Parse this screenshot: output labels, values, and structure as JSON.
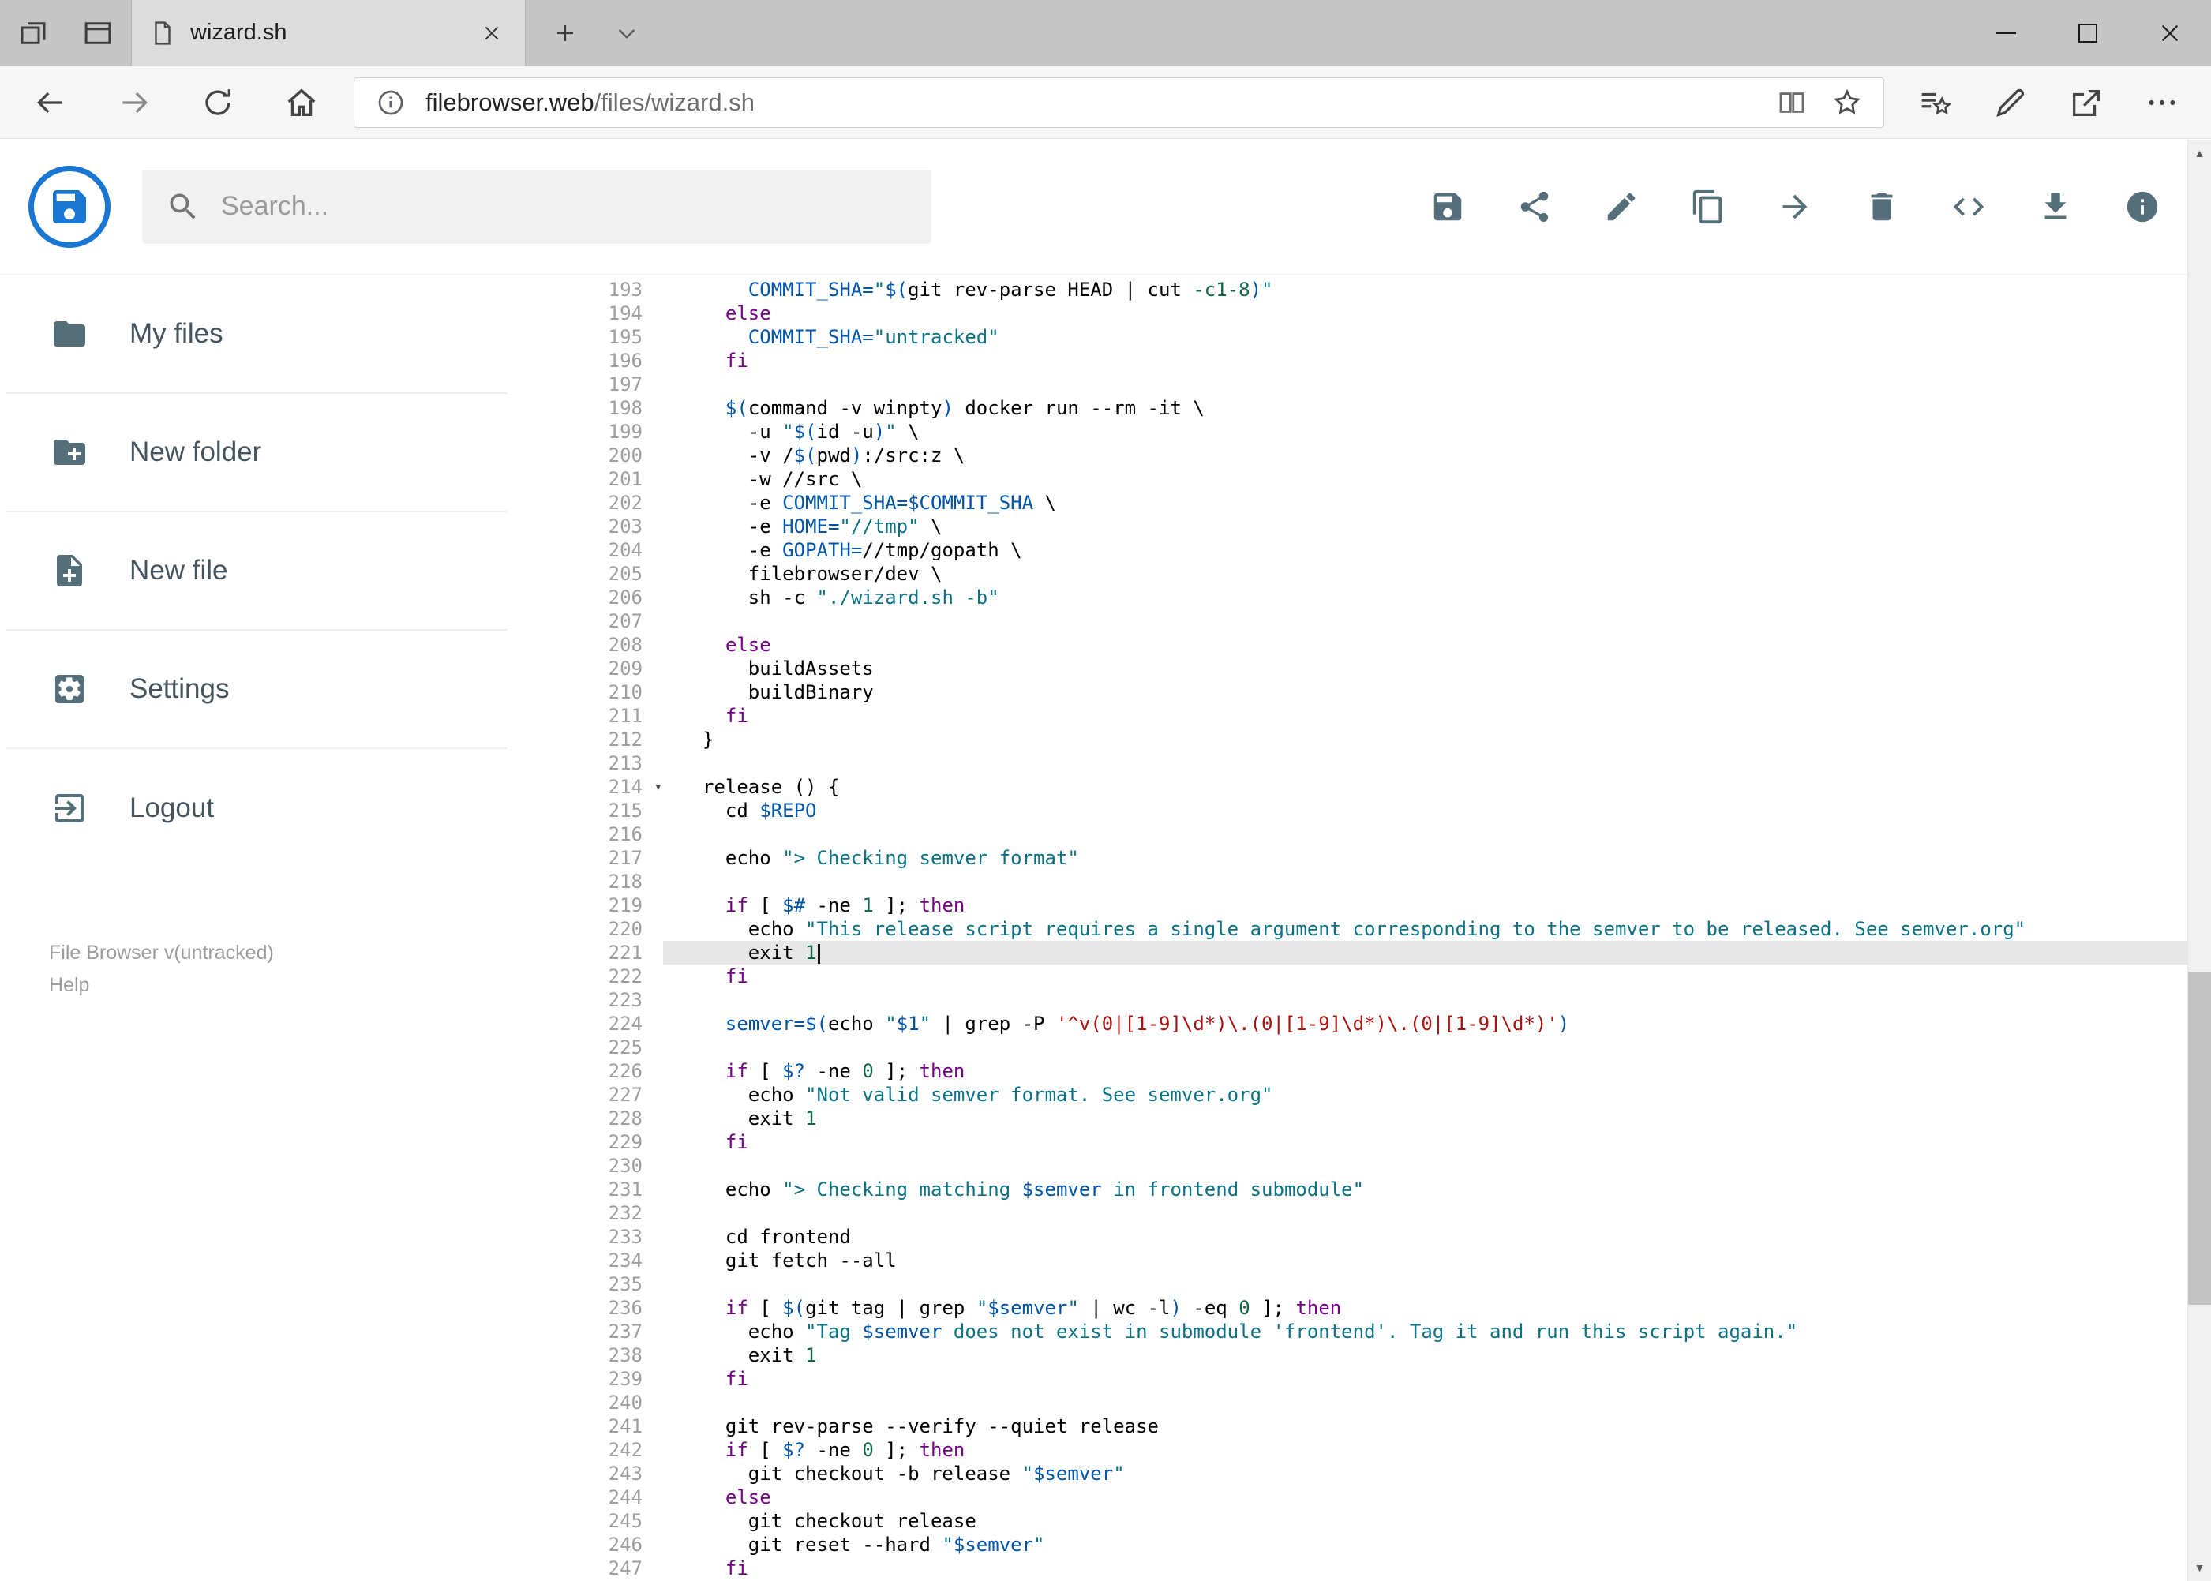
{
  "browser": {
    "tab_title": "wizard.sh",
    "url_domain": "filebrowser.web",
    "url_path": "/files/wizard.sh"
  },
  "header": {
    "search_placeholder": "Search..."
  },
  "toolbar_icons": [
    "save",
    "share",
    "rename",
    "copy",
    "move",
    "delete",
    "raw-code",
    "download",
    "info"
  ],
  "sidebar": {
    "items": [
      {
        "label": "My files",
        "icon": "folder"
      },
      {
        "label": "New folder",
        "icon": "create-new-folder"
      },
      {
        "label": "New file",
        "icon": "new-file"
      },
      {
        "label": "Settings",
        "icon": "settings"
      },
      {
        "label": "Logout",
        "icon": "logout"
      }
    ],
    "footer_version": "File Browser v(untracked)",
    "footer_help": "Help"
  },
  "colors": {
    "accent_blue": "#1976d2",
    "icon_gray": "#546e7a",
    "tok_keyword": "#770088",
    "tok_string": "#0b7285",
    "tok_variable": "#0055aa",
    "tok_number": "#116644",
    "tok_regex": "#aa1111",
    "active_line_bg": "#e7e7e7"
  },
  "editor": {
    "first_line": 193,
    "last_line": 247,
    "active_line": 221,
    "cursor_line": 221,
    "fold_marker_line": 214,
    "lines": [
      {
        "n": 193,
        "t": [
          [
            "pl",
            "    "
          ],
          [
            "vr",
            "COMMIT_SHA="
          ],
          [
            "st",
            "\""
          ],
          [
            "vr",
            "$("
          ],
          [
            "pl",
            "git rev-parse HEAD | cut "
          ],
          [
            "nm",
            "-c1-8"
          ],
          [
            "vr",
            ")"
          ],
          [
            "st",
            "\""
          ]
        ]
      },
      {
        "n": 194,
        "t": [
          [
            "pl",
            "  "
          ],
          [
            "kw",
            "else"
          ]
        ]
      },
      {
        "n": 195,
        "t": [
          [
            "pl",
            "    "
          ],
          [
            "vr",
            "COMMIT_SHA="
          ],
          [
            "st",
            "\"untracked\""
          ]
        ]
      },
      {
        "n": 196,
        "t": [
          [
            "pl",
            "  "
          ],
          [
            "kw",
            "fi"
          ]
        ]
      },
      {
        "n": 197,
        "t": []
      },
      {
        "n": 198,
        "t": [
          [
            "pl",
            "  "
          ],
          [
            "vr",
            "$("
          ],
          [
            "pl",
            "command -v winpty"
          ],
          [
            "vr",
            ")"
          ],
          [
            "pl",
            " docker run --rm -it \\"
          ]
        ]
      },
      {
        "n": 199,
        "t": [
          [
            "pl",
            "    -u "
          ],
          [
            "st",
            "\""
          ],
          [
            "vr",
            "$("
          ],
          [
            "pl",
            "id -u"
          ],
          [
            "vr",
            ")"
          ],
          [
            "st",
            "\""
          ],
          [
            "pl",
            " \\"
          ]
        ]
      },
      {
        "n": 200,
        "t": [
          [
            "pl",
            "    -v /"
          ],
          [
            "vr",
            "$("
          ],
          [
            "pl",
            "pwd"
          ],
          [
            "vr",
            ")"
          ],
          [
            "pl",
            ":/src:z \\"
          ]
        ]
      },
      {
        "n": 201,
        "t": [
          [
            "pl",
            "    -w //src \\"
          ]
        ]
      },
      {
        "n": 202,
        "t": [
          [
            "pl",
            "    -e "
          ],
          [
            "vr",
            "COMMIT_SHA=$COMMIT_SHA"
          ],
          [
            "pl",
            " \\"
          ]
        ]
      },
      {
        "n": 203,
        "t": [
          [
            "pl",
            "    -e "
          ],
          [
            "vr",
            "HOME="
          ],
          [
            "st",
            "\"//tmp\""
          ],
          [
            "pl",
            " \\"
          ]
        ]
      },
      {
        "n": 204,
        "t": [
          [
            "pl",
            "    -e "
          ],
          [
            "vr",
            "GOPATH="
          ],
          [
            "pl",
            "//tmp/gopath \\"
          ]
        ]
      },
      {
        "n": 205,
        "t": [
          [
            "pl",
            "    filebrowser/dev \\"
          ]
        ]
      },
      {
        "n": 206,
        "t": [
          [
            "pl",
            "    sh -c "
          ],
          [
            "st",
            "\"./wizard.sh -b\""
          ]
        ]
      },
      {
        "n": 207,
        "t": []
      },
      {
        "n": 208,
        "t": [
          [
            "pl",
            "  "
          ],
          [
            "kw",
            "else"
          ]
        ]
      },
      {
        "n": 209,
        "t": [
          [
            "pl",
            "    buildAssets"
          ]
        ]
      },
      {
        "n": 210,
        "t": [
          [
            "pl",
            "    buildBinary"
          ]
        ]
      },
      {
        "n": 211,
        "t": [
          [
            "pl",
            "  "
          ],
          [
            "kw",
            "fi"
          ]
        ]
      },
      {
        "n": 212,
        "t": [
          [
            "pl",
            "}"
          ]
        ]
      },
      {
        "n": 213,
        "t": []
      },
      {
        "n": 214,
        "t": [
          [
            "pl",
            "release () {"
          ]
        ]
      },
      {
        "n": 215,
        "t": [
          [
            "pl",
            "  cd "
          ],
          [
            "vr",
            "$REPO"
          ]
        ]
      },
      {
        "n": 216,
        "t": []
      },
      {
        "n": 217,
        "t": [
          [
            "pl",
            "  echo "
          ],
          [
            "st",
            "\"> Checking semver format\""
          ]
        ]
      },
      {
        "n": 218,
        "t": []
      },
      {
        "n": 219,
        "t": [
          [
            "pl",
            "  "
          ],
          [
            "kw",
            "if"
          ],
          [
            "pl",
            " [ "
          ],
          [
            "vr",
            "$#"
          ],
          [
            "pl",
            " -ne "
          ],
          [
            "nm",
            "1"
          ],
          [
            "pl",
            " ]; "
          ],
          [
            "kw",
            "then"
          ]
        ]
      },
      {
        "n": 220,
        "t": [
          [
            "pl",
            "    echo "
          ],
          [
            "st",
            "\"This release script requires a single argument corresponding to the semver to be released. See semver.org\""
          ]
        ]
      },
      {
        "n": 221,
        "t": [
          [
            "pl",
            "    exit "
          ],
          [
            "nm",
            "1"
          ]
        ]
      },
      {
        "n": 222,
        "t": [
          [
            "pl",
            "  "
          ],
          [
            "kw",
            "fi"
          ]
        ]
      },
      {
        "n": 223,
        "t": []
      },
      {
        "n": 224,
        "t": [
          [
            "pl",
            "  "
          ],
          [
            "vr",
            "semver=$("
          ],
          [
            "pl",
            "echo "
          ],
          [
            "st",
            "\""
          ],
          [
            "vr",
            "$1"
          ],
          [
            "st",
            "\""
          ],
          [
            "pl",
            " | grep -P "
          ],
          [
            "rx",
            "'^v(0|[1-9]\\d*)\\.(0|[1-9]\\d*)\\.(0|[1-9]\\d*)'"
          ],
          [
            "vr",
            ")"
          ]
        ]
      },
      {
        "n": 225,
        "t": []
      },
      {
        "n": 226,
        "t": [
          [
            "pl",
            "  "
          ],
          [
            "kw",
            "if"
          ],
          [
            "pl",
            " [ "
          ],
          [
            "vr",
            "$?"
          ],
          [
            "pl",
            " -ne "
          ],
          [
            "nm",
            "0"
          ],
          [
            "pl",
            " ]; "
          ],
          [
            "kw",
            "then"
          ]
        ]
      },
      {
        "n": 227,
        "t": [
          [
            "pl",
            "    echo "
          ],
          [
            "st",
            "\"Not valid semver format. See semver.org\""
          ]
        ]
      },
      {
        "n": 228,
        "t": [
          [
            "pl",
            "    exit "
          ],
          [
            "nm",
            "1"
          ]
        ]
      },
      {
        "n": 229,
        "t": [
          [
            "pl",
            "  "
          ],
          [
            "kw",
            "fi"
          ]
        ]
      },
      {
        "n": 230,
        "t": []
      },
      {
        "n": 231,
        "t": [
          [
            "pl",
            "  echo "
          ],
          [
            "st",
            "\"> Checking matching "
          ],
          [
            "vr",
            "$semver"
          ],
          [
            "st",
            " in frontend submodule\""
          ]
        ]
      },
      {
        "n": 232,
        "t": []
      },
      {
        "n": 233,
        "t": [
          [
            "pl",
            "  cd frontend"
          ]
        ]
      },
      {
        "n": 234,
        "t": [
          [
            "pl",
            "  git fetch --all"
          ]
        ]
      },
      {
        "n": 235,
        "t": []
      },
      {
        "n": 236,
        "t": [
          [
            "pl",
            "  "
          ],
          [
            "kw",
            "if"
          ],
          [
            "pl",
            " [ "
          ],
          [
            "vr",
            "$("
          ],
          [
            "pl",
            "git tag | grep "
          ],
          [
            "st",
            "\""
          ],
          [
            "vr",
            "$semver"
          ],
          [
            "st",
            "\""
          ],
          [
            "pl",
            " | wc -l"
          ],
          [
            "vr",
            ")"
          ],
          [
            "pl",
            " -eq "
          ],
          [
            "nm",
            "0"
          ],
          [
            "pl",
            " ]; "
          ],
          [
            "kw",
            "then"
          ]
        ]
      },
      {
        "n": 237,
        "t": [
          [
            "pl",
            "    echo "
          ],
          [
            "st",
            "\"Tag "
          ],
          [
            "vr",
            "$semver"
          ],
          [
            "st",
            " does not exist in submodule 'frontend'. Tag it and run this script again.\""
          ]
        ]
      },
      {
        "n": 238,
        "t": [
          [
            "pl",
            "    exit "
          ],
          [
            "nm",
            "1"
          ]
        ]
      },
      {
        "n": 239,
        "t": [
          [
            "pl",
            "  "
          ],
          [
            "kw",
            "fi"
          ]
        ]
      },
      {
        "n": 240,
        "t": []
      },
      {
        "n": 241,
        "t": [
          [
            "pl",
            "  git rev-parse --verify --quiet release"
          ]
        ]
      },
      {
        "n": 242,
        "t": [
          [
            "pl",
            "  "
          ],
          [
            "kw",
            "if"
          ],
          [
            "pl",
            " [ "
          ],
          [
            "vr",
            "$?"
          ],
          [
            "pl",
            " -ne "
          ],
          [
            "nm",
            "0"
          ],
          [
            "pl",
            " ]; "
          ],
          [
            "kw",
            "then"
          ]
        ]
      },
      {
        "n": 243,
        "t": [
          [
            "pl",
            "    git checkout -b release "
          ],
          [
            "st",
            "\""
          ],
          [
            "vr",
            "$semver"
          ],
          [
            "st",
            "\""
          ]
        ]
      },
      {
        "n": 244,
        "t": [
          [
            "pl",
            "  "
          ],
          [
            "kw",
            "else"
          ]
        ]
      },
      {
        "n": 245,
        "t": [
          [
            "pl",
            "    git checkout release"
          ]
        ]
      },
      {
        "n": 246,
        "t": [
          [
            "pl",
            "    git reset --hard "
          ],
          [
            "st",
            "\""
          ],
          [
            "vr",
            "$semver"
          ],
          [
            "st",
            "\""
          ]
        ]
      },
      {
        "n": 247,
        "t": [
          [
            "pl",
            "  "
          ],
          [
            "kw",
            "fi"
          ]
        ]
      }
    ]
  }
}
